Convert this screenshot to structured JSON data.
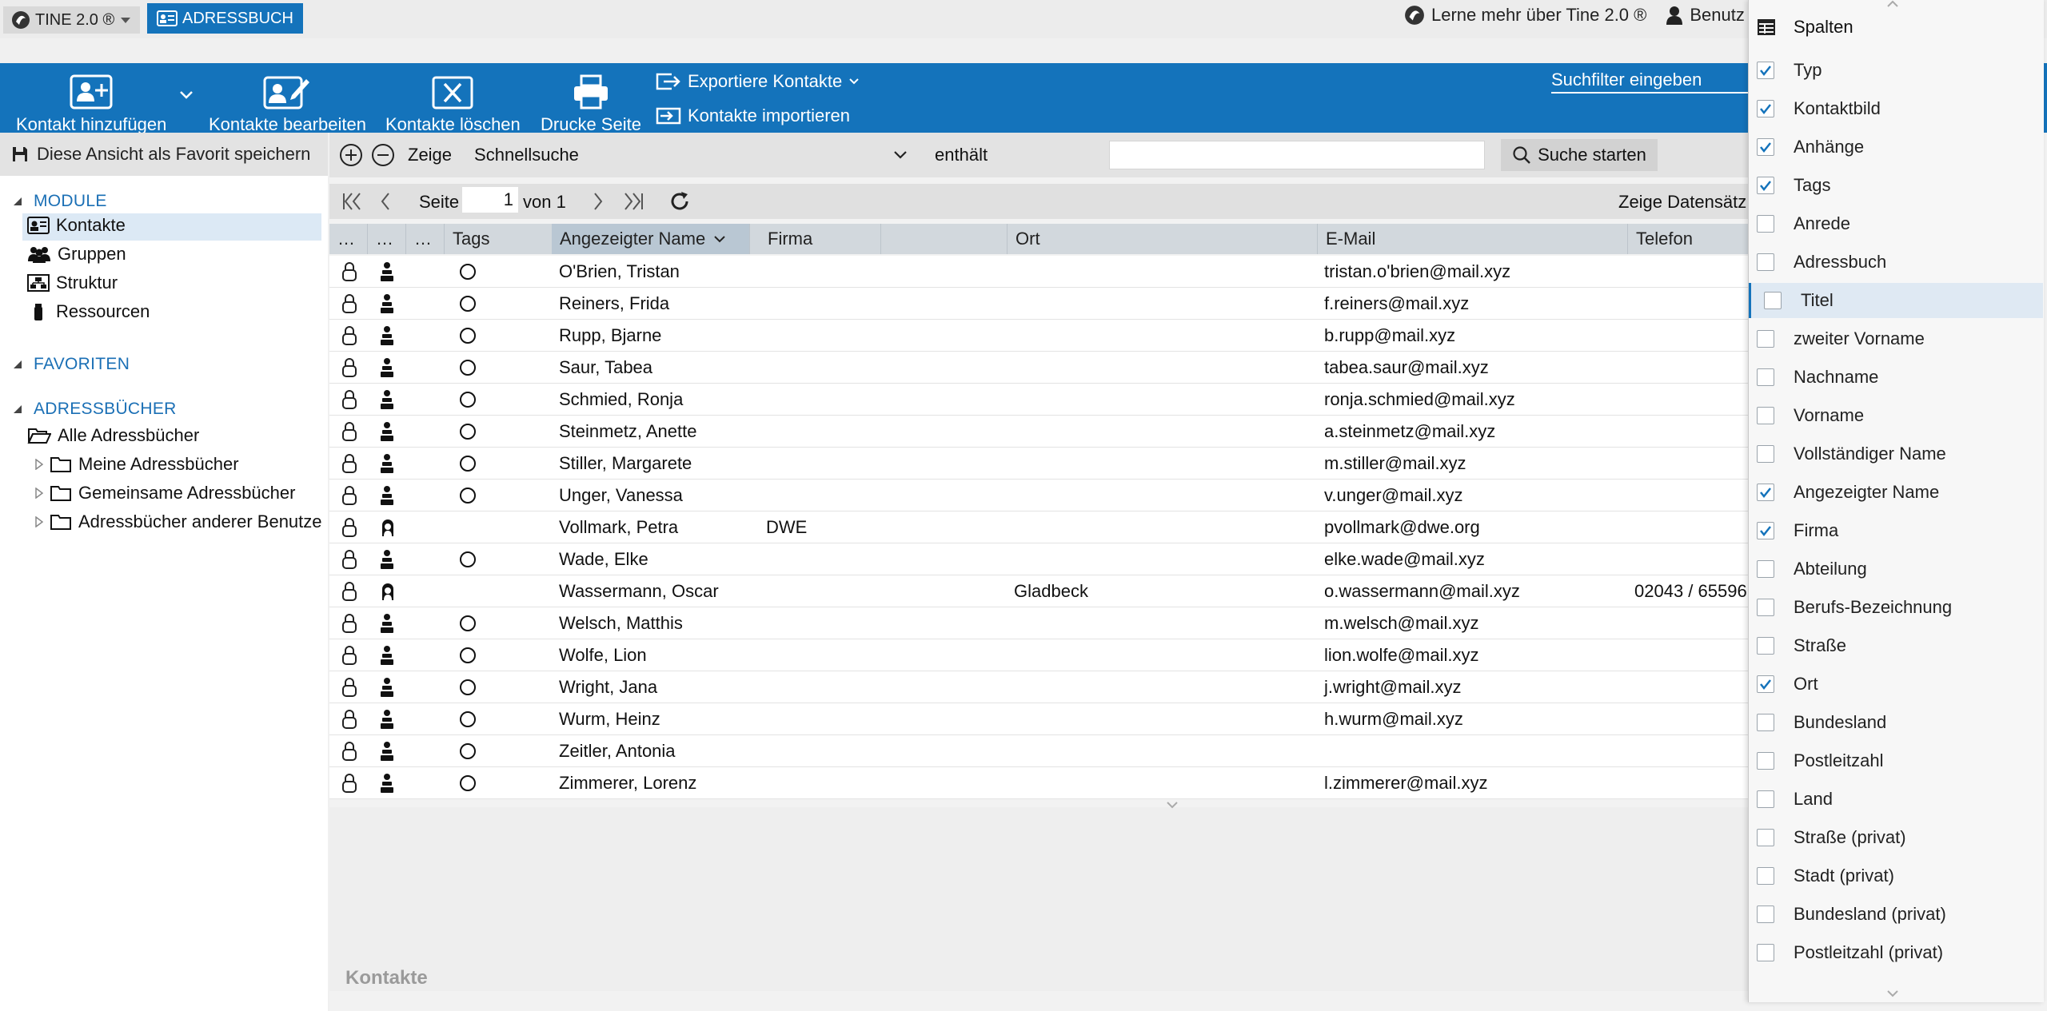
{
  "app": {
    "menu_label": "TINE 2.0 ®",
    "tab_label": "ADRESSBUCH",
    "learn_more": "Lerne mehr über Tine 2.0 ®",
    "user_label": "Benutz"
  },
  "toolbar": {
    "add_contact": "Kontakt hinzufügen",
    "edit_contacts": "Kontakte bearbeiten",
    "delete_contacts": "Kontakte löschen",
    "print_page": "Drucke Seite",
    "export_contacts": "Exportiere Kontakte",
    "import_contacts": "Kontakte importieren",
    "search_filter": "Suchfilter eingeben"
  },
  "left": {
    "save_favorite": "Diese Ansicht als Favorit speichern",
    "modules_header": "MODULE",
    "modules": [
      "Kontakte",
      "Gruppen",
      "Struktur",
      "Ressourcen"
    ],
    "favorites_header": "FAVORITEN",
    "addressbooks_header": "ADRESSBÜCHER",
    "all_addressbooks": "Alle Adressbücher",
    "addressbooks": [
      "Meine Adressbücher",
      "Gemeinsame Adressbücher",
      "Adressbücher anderer Benutze"
    ]
  },
  "search": {
    "show_label": "Zeige",
    "filter_value": "Schnellsuche",
    "operator": "enthält",
    "start_button": "Suche starten"
  },
  "paging": {
    "page_label": "Seite",
    "page_value": "1",
    "of_label": "von 1",
    "records_label": "Zeige Datensätz"
  },
  "grid": {
    "columns": [
      "…",
      "…",
      "…",
      "Tags",
      "Angezeigter Name",
      "Firma",
      "Ort",
      "E-Mail",
      "Telefon"
    ],
    "rows": [
      {
        "type": "user",
        "tag": true,
        "name": "O'Brien, Tristan",
        "firma": "",
        "ort": "",
        "email": "tristan.o'brien@mail.xyz",
        "telefon": ""
      },
      {
        "type": "user",
        "tag": true,
        "name": "Reiners, Frida",
        "firma": "",
        "ort": "",
        "email": "f.reiners@mail.xyz",
        "telefon": ""
      },
      {
        "type": "user",
        "tag": true,
        "name": "Rupp, Bjarne",
        "firma": "",
        "ort": "",
        "email": "b.rupp@mail.xyz",
        "telefon": ""
      },
      {
        "type": "user",
        "tag": true,
        "name": "Saur, Tabea",
        "firma": "",
        "ort": "",
        "email": "tabea.saur@mail.xyz",
        "telefon": ""
      },
      {
        "type": "user",
        "tag": true,
        "name": "Schmied, Ronja",
        "firma": "",
        "ort": "",
        "email": "ronja.schmied@mail.xyz",
        "telefon": ""
      },
      {
        "type": "user",
        "tag": true,
        "name": "Steinmetz, Anette",
        "firma": "",
        "ort": "",
        "email": "a.steinmetz@mail.xyz",
        "telefon": ""
      },
      {
        "type": "user",
        "tag": true,
        "name": "Stiller, Margarete",
        "firma": "",
        "ort": "",
        "email": "m.stiller@mail.xyz",
        "telefon": ""
      },
      {
        "type": "user",
        "tag": true,
        "name": "Unger, Vanessa",
        "firma": "",
        "ort": "",
        "email": "v.unger@mail.xyz",
        "telefon": ""
      },
      {
        "type": "contact",
        "tag": false,
        "name": "Vollmark, Petra",
        "firma": "DWE",
        "ort": "",
        "email": "pvollmark@dwe.org",
        "telefon": ""
      },
      {
        "type": "user",
        "tag": true,
        "name": "Wade, Elke",
        "firma": "",
        "ort": "",
        "email": "elke.wade@mail.xyz",
        "telefon": ""
      },
      {
        "type": "contact",
        "tag": false,
        "name": "Wassermann, Oscar",
        "firma": "",
        "ort": "Gladbeck",
        "email": "o.wassermann@mail.xyz",
        "telefon": "02043 / 65596"
      },
      {
        "type": "user",
        "tag": true,
        "name": "Welsch, Matthis",
        "firma": "",
        "ort": "",
        "email": "m.welsch@mail.xyz",
        "telefon": ""
      },
      {
        "type": "user",
        "tag": true,
        "name": "Wolfe, Lion",
        "firma": "",
        "ort": "",
        "email": "lion.wolfe@mail.xyz",
        "telefon": ""
      },
      {
        "type": "user",
        "tag": true,
        "name": "Wright, Jana",
        "firma": "",
        "ort": "",
        "email": "j.wright@mail.xyz",
        "telefon": ""
      },
      {
        "type": "user",
        "tag": true,
        "name": "Wurm, Heinz",
        "firma": "",
        "ort": "",
        "email": "h.wurm@mail.xyz",
        "telefon": ""
      },
      {
        "type": "user",
        "tag": true,
        "name": "Zeitler, Antonia",
        "firma": "",
        "ort": "",
        "email": "",
        "telefon": ""
      },
      {
        "type": "user",
        "tag": true,
        "name": "Zimmerer, Lorenz",
        "firma": "",
        "ort": "",
        "email": "l.zimmerer@mail.xyz",
        "telefon": ""
      }
    ]
  },
  "status": {
    "title": "Kontakte"
  },
  "column_menu": {
    "title": "Spalten",
    "items": [
      {
        "label": "Typ",
        "checked": true
      },
      {
        "label": "Kontaktbild",
        "checked": true
      },
      {
        "label": "Anhänge",
        "checked": true
      },
      {
        "label": "Tags",
        "checked": true
      },
      {
        "label": "Anrede",
        "checked": false
      },
      {
        "label": "Adressbuch",
        "checked": false
      },
      {
        "label": "Titel",
        "checked": false,
        "active": true
      },
      {
        "label": "zweiter Vorname",
        "checked": false
      },
      {
        "label": "Nachname",
        "checked": false
      },
      {
        "label": "Vorname",
        "checked": false
      },
      {
        "label": "Vollständiger Name",
        "checked": false
      },
      {
        "label": "Angezeigter Name",
        "checked": true
      },
      {
        "label": "Firma",
        "checked": true
      },
      {
        "label": "Abteilung",
        "checked": false
      },
      {
        "label": "Berufs-Bezeichnung",
        "checked": false
      },
      {
        "label": "Straße",
        "checked": false
      },
      {
        "label": "Ort",
        "checked": true
      },
      {
        "label": "Bundesland",
        "checked": false
      },
      {
        "label": "Postleitzahl",
        "checked": false
      },
      {
        "label": "Land",
        "checked": false
      },
      {
        "label": "Straße (privat)",
        "checked": false
      },
      {
        "label": "Stadt (privat)",
        "checked": false
      },
      {
        "label": "Bundesland (privat)",
        "checked": false
      },
      {
        "label": "Postleitzahl (privat)",
        "checked": false
      }
    ]
  },
  "colors": {
    "accent": "#1473bb",
    "selected": "#dce9f5",
    "section": "#1a6fb5"
  }
}
